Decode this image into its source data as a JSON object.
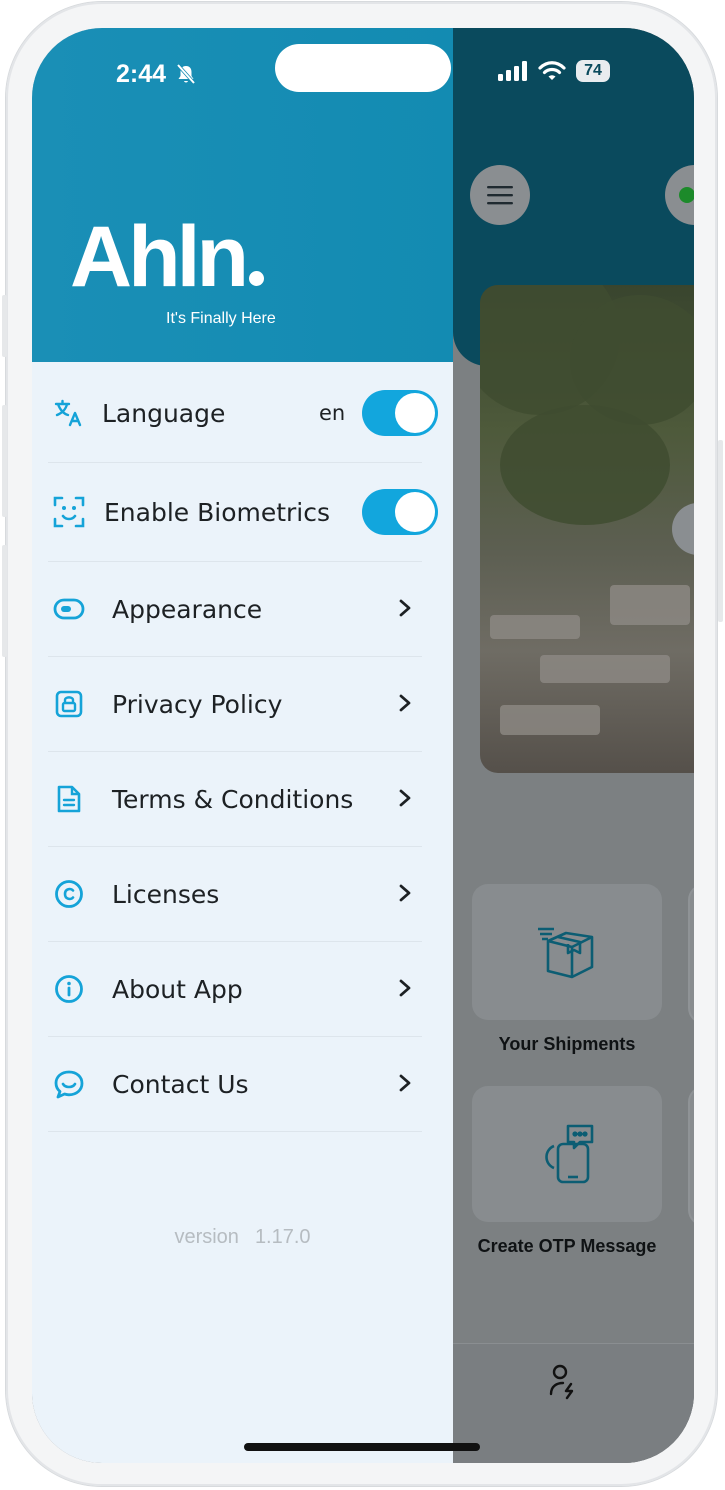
{
  "status_bar": {
    "time": "2:44",
    "battery": "74"
  },
  "drawer": {
    "logo_text": "Ahln",
    "tagline": "It's Finally Here",
    "menu": [
      {
        "key": "language",
        "label": "Language",
        "icon": "translate-icon",
        "value": "en",
        "control": "toggle",
        "on": true
      },
      {
        "key": "biometrics",
        "label": "Enable Biometrics",
        "icon": "face-scan-icon",
        "control": "toggle",
        "on": true
      },
      {
        "key": "appearance",
        "label": "Appearance",
        "icon": "toggle-outline-icon",
        "control": "chevron"
      },
      {
        "key": "privacy",
        "label": "Privacy Policy",
        "icon": "lock-badge-icon",
        "control": "chevron"
      },
      {
        "key": "terms",
        "label": "Terms & Conditions",
        "icon": "document-icon",
        "control": "chevron"
      },
      {
        "key": "licenses",
        "label": "Licenses",
        "icon": "copyright-icon",
        "control": "chevron"
      },
      {
        "key": "about",
        "label": "About App",
        "icon": "info-icon",
        "control": "chevron"
      },
      {
        "key": "contact",
        "label": "Contact Us",
        "icon": "chat-bubble-icon",
        "control": "chevron"
      }
    ],
    "version_label": "version",
    "version_value": "1.17.0"
  },
  "background_app": {
    "tiles": [
      {
        "label": "Your Shipments",
        "icon": "package-icon"
      },
      {
        "label": "Create OTP Message",
        "icon": "otp-message-icon"
      }
    ]
  },
  "colors": {
    "accent": "#12a6dd",
    "header": "#138bb2",
    "drawer_bg": "#ebf3fa",
    "icon": "#15a3d8"
  }
}
